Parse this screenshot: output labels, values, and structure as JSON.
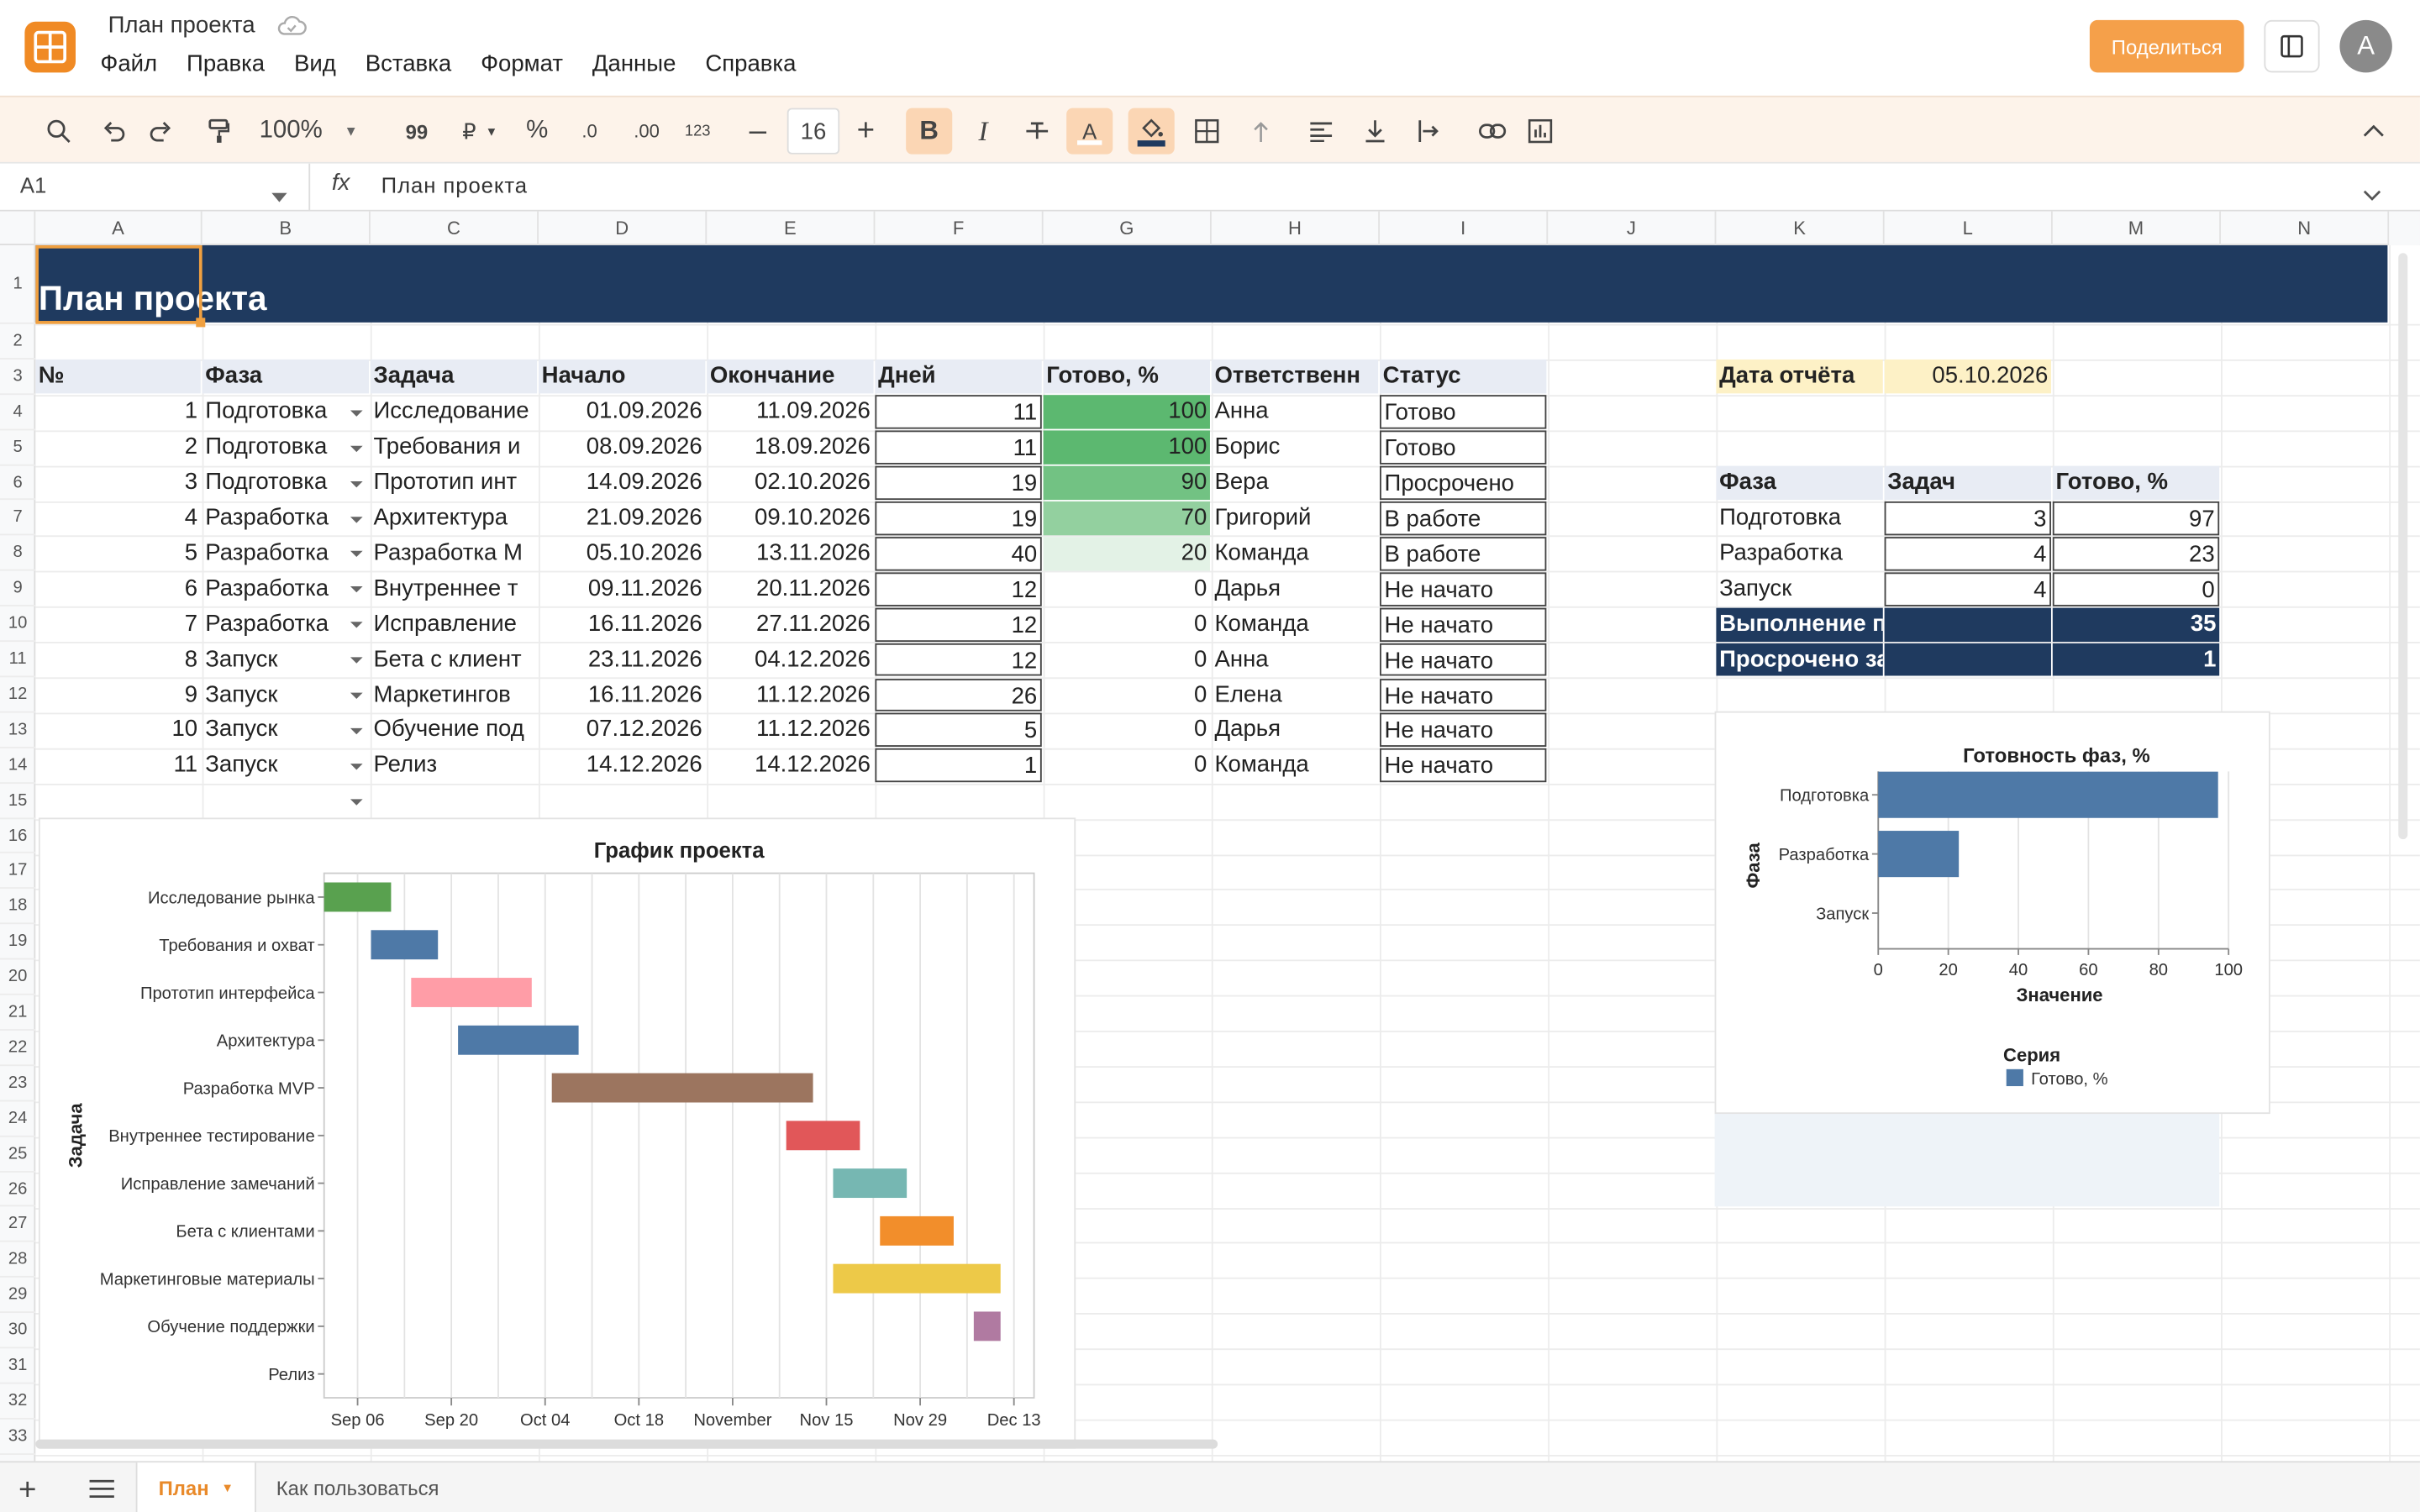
{
  "app": {
    "doc_title": "План проекта",
    "share_label": "Поделиться",
    "avatar_letter": "A",
    "accent": "#f08a24"
  },
  "menu": [
    "Файл",
    "Правка",
    "Вид",
    "Вставка",
    "Формат",
    "Данные",
    "Справка"
  ],
  "toolbar": {
    "zoom": "100%",
    "font_size": "16",
    "quote": "99",
    "currency": "₽",
    "percent": "%",
    "dec_minus": ".0",
    "dec_plus": ".00",
    "numfmt": "123",
    "bold": "B",
    "italic": "I",
    "text_color": "A"
  },
  "formula_bar": {
    "cell_ref": "A1",
    "fx": "fx",
    "content": "План проекта"
  },
  "columns": [
    "A",
    "B",
    "C",
    "D",
    "E",
    "F",
    "G",
    "H",
    "I",
    "J",
    "K",
    "L",
    "M",
    "N"
  ],
  "rows": [
    "1",
    "2",
    "3",
    "4",
    "5",
    "6",
    "7",
    "8",
    "9",
    "10",
    "11",
    "12",
    "13",
    "14",
    "15",
    "16",
    "17",
    "18",
    "19",
    "20",
    "21",
    "22",
    "23",
    "24",
    "25",
    "26",
    "27",
    "28",
    "29",
    "30",
    "31",
    "32",
    "33"
  ],
  "title_banner": "План проекта",
  "table": {
    "headers": [
      "№",
      "Фаза",
      "Задача",
      "Начало",
      "Окончание",
      "Дней",
      "Готово, %",
      "Ответственн",
      "Статус"
    ],
    "rows": [
      [
        "1",
        "Подготовка",
        "Исследование",
        "01.09.2026",
        "11.09.2026",
        "11",
        "100",
        "Анна",
        "Готово"
      ],
      [
        "2",
        "Подготовка",
        "Требования и",
        "08.09.2026",
        "18.09.2026",
        "11",
        "100",
        "Борис",
        "Готово"
      ],
      [
        "3",
        "Подготовка",
        "Прототип инт",
        "14.09.2026",
        "02.10.2026",
        "19",
        "90",
        "Вера",
        "Просрочено"
      ],
      [
        "4",
        "Разработка",
        "Архитектура",
        "21.09.2026",
        "09.10.2026",
        "19",
        "70",
        "Григорий",
        "В работе"
      ],
      [
        "5",
        "Разработка",
        "Разработка M",
        "05.10.2026",
        "13.11.2026",
        "40",
        "20",
        "Команда",
        "В работе"
      ],
      [
        "6",
        "Разработка",
        "Внутреннее т",
        "09.11.2026",
        "20.11.2026",
        "12",
        "0",
        "Дарья",
        "Не начато"
      ],
      [
        "7",
        "Разработка",
        "Исправление",
        "16.11.2026",
        "27.11.2026",
        "12",
        "0",
        "Команда",
        "Не начато"
      ],
      [
        "8",
        "Запуск",
        "Бета с клиент",
        "23.11.2026",
        "04.12.2026",
        "12",
        "0",
        "Анна",
        "Не начато"
      ],
      [
        "9",
        "Запуск",
        "Маркетингов",
        "16.11.2026",
        "11.12.2026",
        "26",
        "0",
        "Елена",
        "Не начато"
      ],
      [
        "10",
        "Запуск",
        "Обучение под",
        "07.12.2026",
        "11.12.2026",
        "5",
        "0",
        "Дарья",
        "Не начато"
      ],
      [
        "11",
        "Запуск",
        "Релиз",
        "14.12.2026",
        "14.12.2026",
        "1",
        "0",
        "Команда",
        "Не начато"
      ]
    ]
  },
  "report": {
    "label": "Дата отчёта",
    "value": "05.10.2026"
  },
  "summary": {
    "headers": [
      "Фаза",
      "Задач",
      "Готово, %"
    ],
    "rows": [
      [
        "Подготовка",
        "3",
        "97"
      ],
      [
        "Разработка",
        "4",
        "23"
      ],
      [
        "Запуск",
        "4",
        "0"
      ]
    ],
    "completion_label": "Выполнение проекта, %",
    "completion_value": "35",
    "overdue_label": "Просрочено задач",
    "overdue_value": "1"
  },
  "chart_data": [
    {
      "type": "gantt",
      "title": "График проекта",
      "ylabel": "Задача",
      "tasks": [
        {
          "name": "Исследование рынка",
          "start": "2026-09-01",
          "end": "2026-09-11",
          "color": "#59a14f"
        },
        {
          "name": "Требования и охват",
          "start": "2026-09-08",
          "end": "2026-09-18",
          "color": "#4e79a7"
        },
        {
          "name": "Прототип интерфейса",
          "start": "2026-09-14",
          "end": "2026-10-02",
          "color": "#ff9da7"
        },
        {
          "name": "Архитектура",
          "start": "2026-09-21",
          "end": "2026-10-09",
          "color": "#4e79a7"
        },
        {
          "name": "Разработка MVP",
          "start": "2026-10-05",
          "end": "2026-11-13",
          "color": "#9c755f"
        },
        {
          "name": "Внутреннее тестирование",
          "start": "2026-11-09",
          "end": "2026-11-20",
          "color": "#e15759"
        },
        {
          "name": "Исправление замечаний",
          "start": "2026-11-16",
          "end": "2026-11-27",
          "color": "#76b7b2"
        },
        {
          "name": "Бета с клиентами",
          "start": "2026-11-23",
          "end": "2026-12-04",
          "color": "#f28e2b"
        },
        {
          "name": "Маркетинговые материалы",
          "start": "2026-11-16",
          "end": "2026-12-11",
          "color": "#edc948"
        },
        {
          "name": "Обучение поддержки",
          "start": "2026-12-07",
          "end": "2026-12-11",
          "color": "#b07aa1"
        },
        {
          "name": "Релиз",
          "start": "2026-12-14",
          "end": "2026-12-14",
          "color": "#bab0ac"
        }
      ],
      "x_ticks": [
        {
          "label": "Sep 06",
          "date": "2026-09-06"
        },
        {
          "label": "Sep 20",
          "date": "2026-09-20"
        },
        {
          "label": "Oct 04",
          "date": "2026-10-04"
        },
        {
          "label": "Oct 18",
          "date": "2026-10-18"
        },
        {
          "label": "November",
          "date": "2026-11-01"
        },
        {
          "label": "Nov 15",
          "date": "2026-11-15"
        },
        {
          "label": "Nov 29",
          "date": "2026-11-29"
        },
        {
          "label": "Dec 13",
          "date": "2026-12-13"
        }
      ],
      "xlim": [
        "2026-09-01",
        "2026-12-16"
      ],
      "grid": true
    },
    {
      "type": "bar",
      "orientation": "horizontal",
      "title": "Готовность фаз, %",
      "categories": [
        "Подготовка",
        "Разработка",
        "Запуск"
      ],
      "series": [
        {
          "name": "Готово, %",
          "values": [
            97,
            23,
            0
          ],
          "color": "#4e79a7"
        }
      ],
      "xlabel": "Значение",
      "ylabel": "Фаза",
      "xlim": [
        0,
        100
      ],
      "x_ticks": [
        0,
        20,
        40,
        60,
        80,
        100
      ],
      "legend_title": "Серия",
      "legend_position": "bottom",
      "grid": true
    }
  ]
}
